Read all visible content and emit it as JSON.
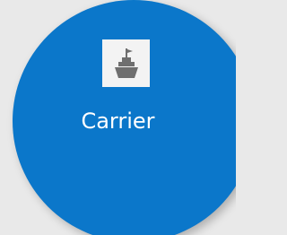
{
  "tile": {
    "label": "Carrier",
    "icon": "ship-icon",
    "colors": {
      "background": "#e9e9e9",
      "tile": "#0b77ca",
      "icon_box": "#f3f3f3",
      "icon": "#6f6f6f",
      "label": "#ffffff"
    }
  }
}
